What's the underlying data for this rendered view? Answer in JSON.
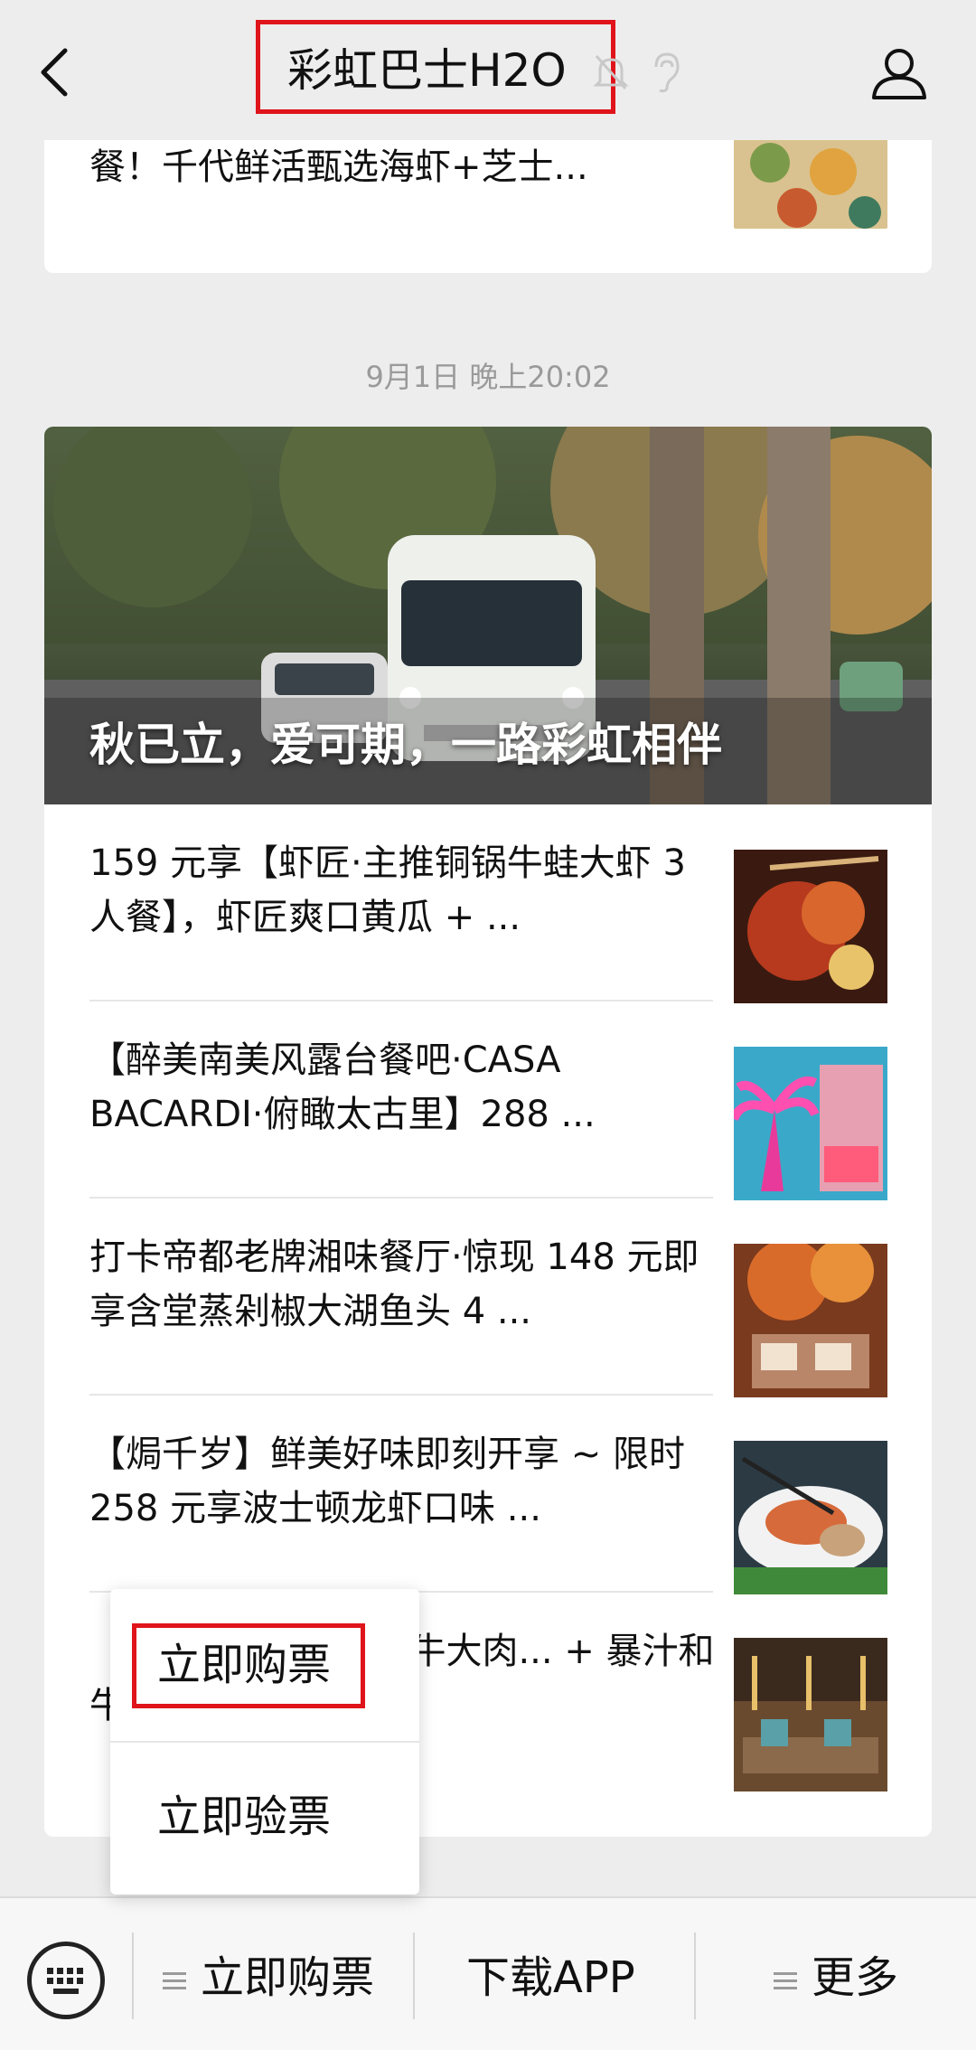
{
  "header": {
    "title": "彩虹巴士H2O",
    "back_icon": "chevron-left-icon",
    "mute_icon": "bell-off-icon",
    "ear_icon": "ear-icon",
    "profile_icon": "person-icon"
  },
  "feed": {
    "top_card_text": "餐！千代鲜活甄选海虾+芝士...",
    "timestamp": "9月1日 晚上20:02",
    "cover_title": "秋已立，爱可期，一路彩虹相伴",
    "articles": [
      {
        "title": "159 元享【虾匠·主推铜锅牛蛙大虾 3 人餐】，虾匠爽口黄瓜 + ..."
      },
      {
        "title": "【醉美南美风露台餐吧·CASA BACARDI·俯瞰太古里】288 ..."
      },
      {
        "title": "打卡帝都老牌湘味餐厅·惊现 148 元即享含堂蒸剁椒大湖鱼头 4 ..."
      },
      {
        "title": "【焗千岁】鲜美好味即刻开享 ~ 限时 258 元享波士顿龙虾口味 ..."
      },
      {
        "title": "【嘻】... 19 元享黑牛大肉... + 暴汁和牛..."
      }
    ]
  },
  "popup": {
    "items": [
      "立即购票",
      "立即验票"
    ]
  },
  "bottom_bar": {
    "keyboard_icon": "keyboard-icon",
    "items": [
      "立即购票",
      "下载APP",
      "更多"
    ]
  },
  "colors": {
    "highlight": "#e0141b",
    "background": "#ededed"
  }
}
